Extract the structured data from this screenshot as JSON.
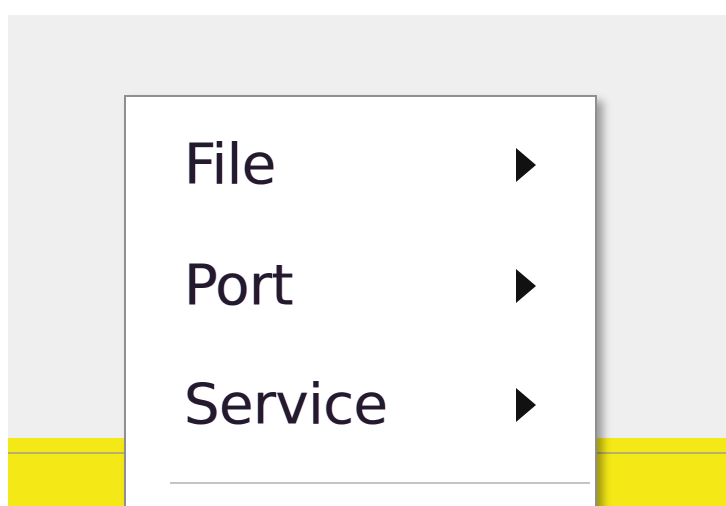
{
  "menu": {
    "items": [
      {
        "label": "File",
        "icon": "submenu-arrow-icon"
      },
      {
        "label": "Port",
        "icon": "submenu-arrow-icon"
      },
      {
        "label": "Service",
        "icon": "submenu-arrow-icon"
      }
    ]
  },
  "colors": {
    "background": "#efefef",
    "menu_background": "#ffffff",
    "menu_border": "#8f8f8f",
    "text": "#231a2d",
    "accent_band": "#f4e817"
  }
}
